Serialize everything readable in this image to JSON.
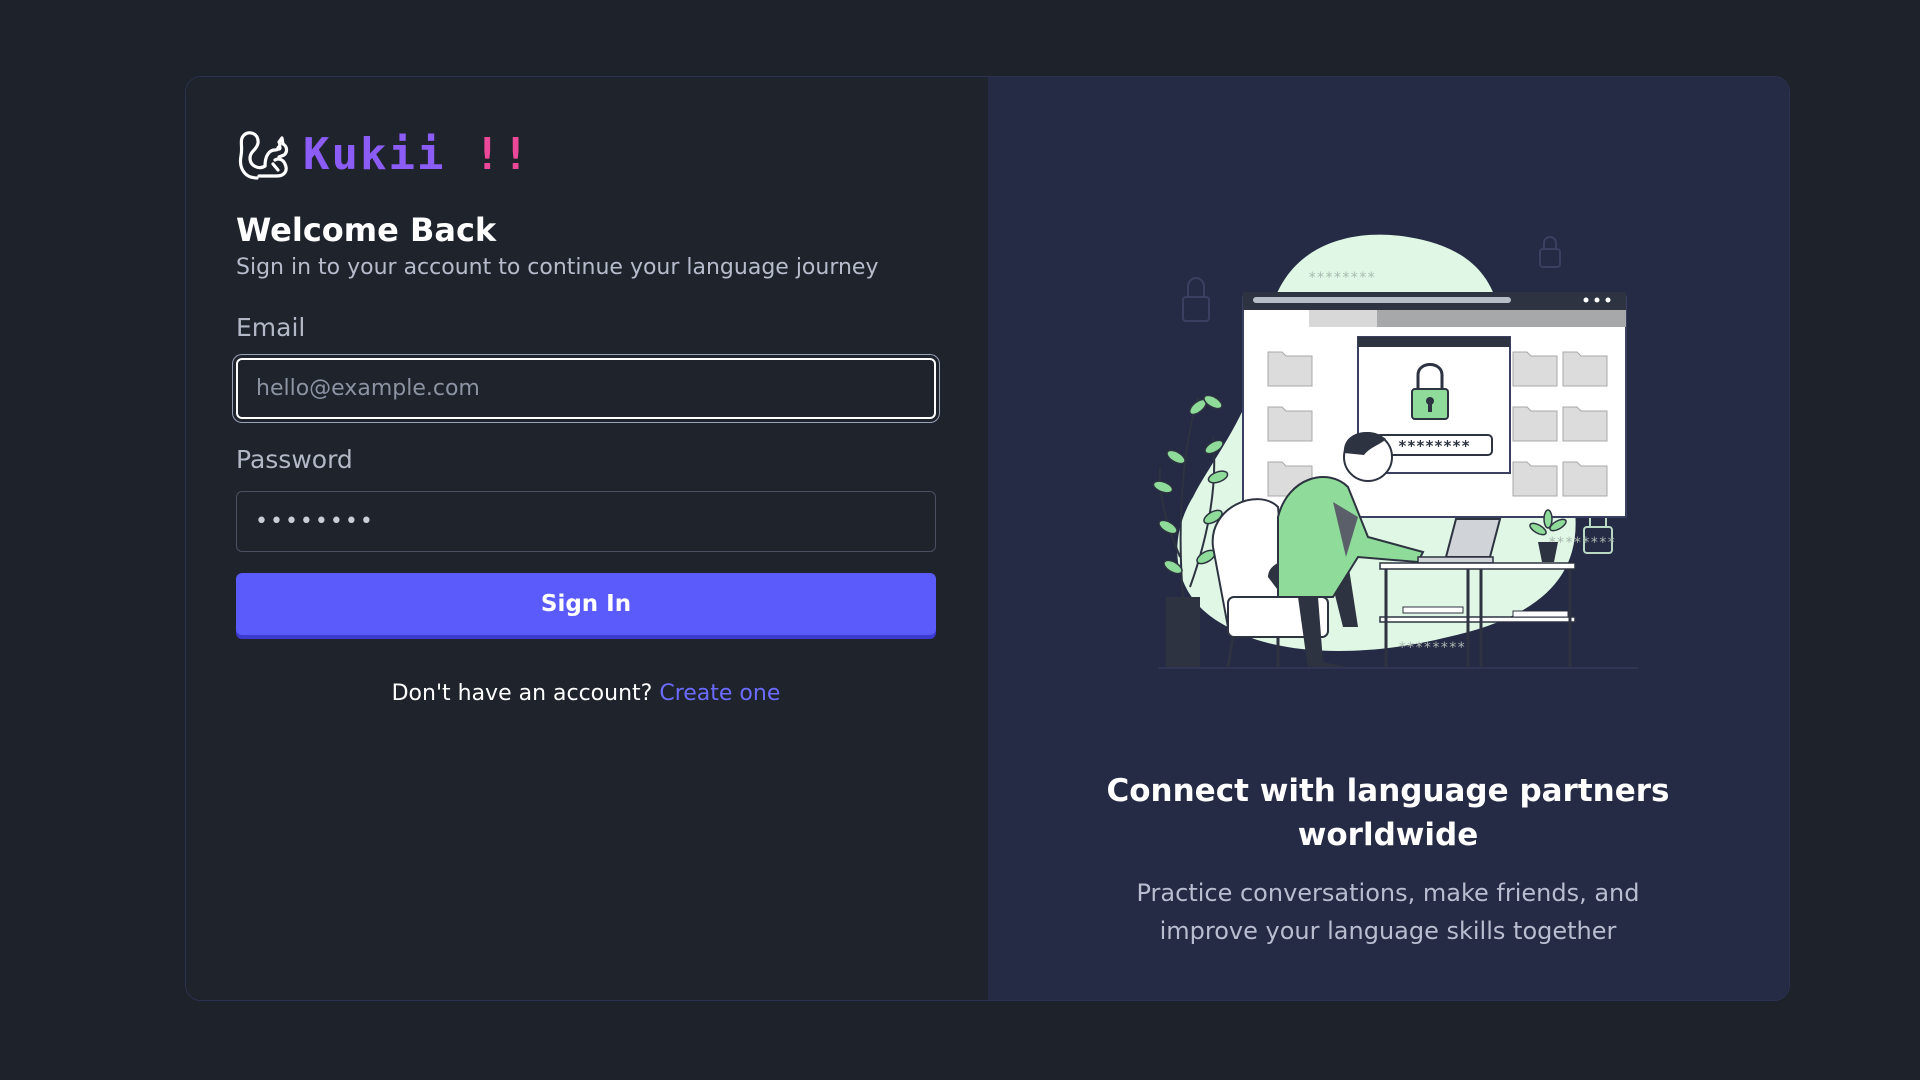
{
  "brand": {
    "name": "Kukii",
    "suffix": " !!",
    "icon": "squirrel-icon"
  },
  "login": {
    "title": "Welcome Back",
    "subtitle": "Sign in to your account to continue your language journey",
    "email_label": "Email",
    "email_placeholder": "hello@example.com",
    "email_value": "",
    "password_label": "Password",
    "password_value": "••••••••",
    "submit_label": "Sign In",
    "signup_prompt": "Don't have an account? ",
    "signup_link": "Create one"
  },
  "promo": {
    "title": "Connect with language partners worldwide",
    "text": "Practice conversations, make friends, and improve your language skills together",
    "illustration": {
      "password_mask": "********",
      "icons": [
        "lock-icon",
        "folder-icon",
        "plant-icon",
        "laptop-icon",
        "armchair-icon"
      ]
    }
  },
  "colors": {
    "background": "#1d222b",
    "panel_left": "#1e232c",
    "panel_right": "#252a45",
    "accent": "#5b5bfb",
    "brand_purple": "#8b5cf6",
    "brand_pink": "#ec4899",
    "illustration_green": "#8fdc9a",
    "illustration_blob": "#dff7e4"
  }
}
